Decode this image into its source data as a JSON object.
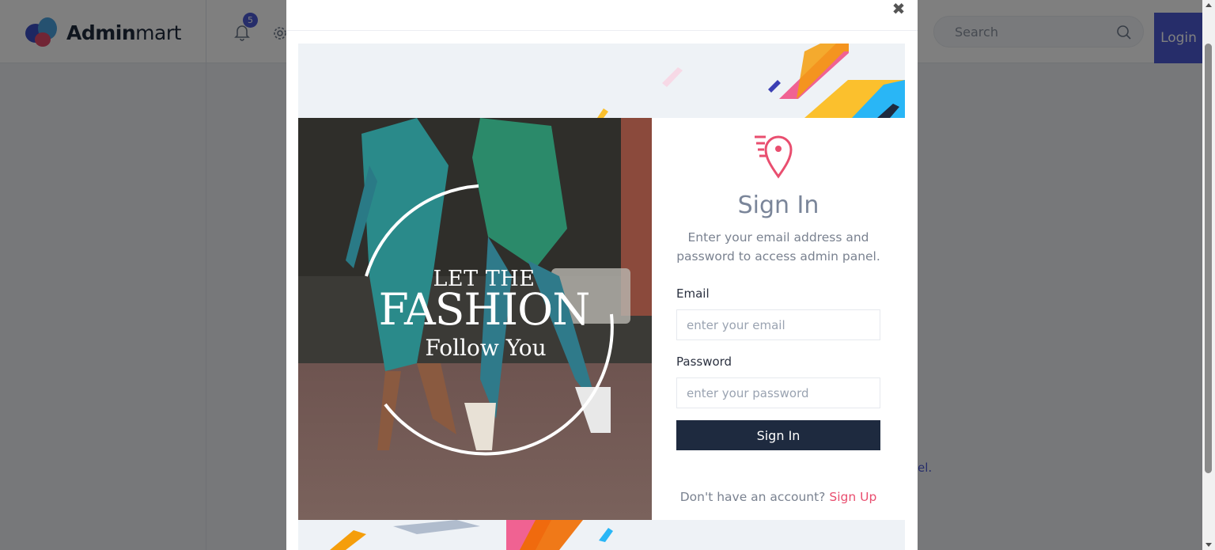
{
  "app": {
    "brand_bold": "Admin",
    "brand_light": "mart",
    "notification_count": "5",
    "search_placeholder": "Search",
    "login_label": "Login",
    "background_link_fragment": "el."
  },
  "modal": {
    "close_symbol": "✖",
    "image_text": {
      "line1": "LET THE",
      "line2": "FASHION",
      "line3": "Follow You"
    },
    "signin": {
      "title": "Sign In",
      "description": "Enter your email address and password to access admin panel.",
      "email_label": "Email",
      "email_placeholder": "enter your email",
      "password_label": "Password",
      "password_placeholder": "enter your password",
      "submit_label": "Sign In",
      "signup_prompt": "Don't have an account?",
      "signup_link": "Sign Up"
    }
  },
  "icons": [
    "logo-butterfly-icon",
    "bell-icon",
    "gear-icon",
    "search-icon",
    "close-icon",
    "location-pin-icon"
  ],
  "colors": {
    "accent": "#4c5bd4",
    "signin_button": "#1e2a3f",
    "signup_link": "#e94e6f",
    "pin_icon": "#e94e6f"
  }
}
